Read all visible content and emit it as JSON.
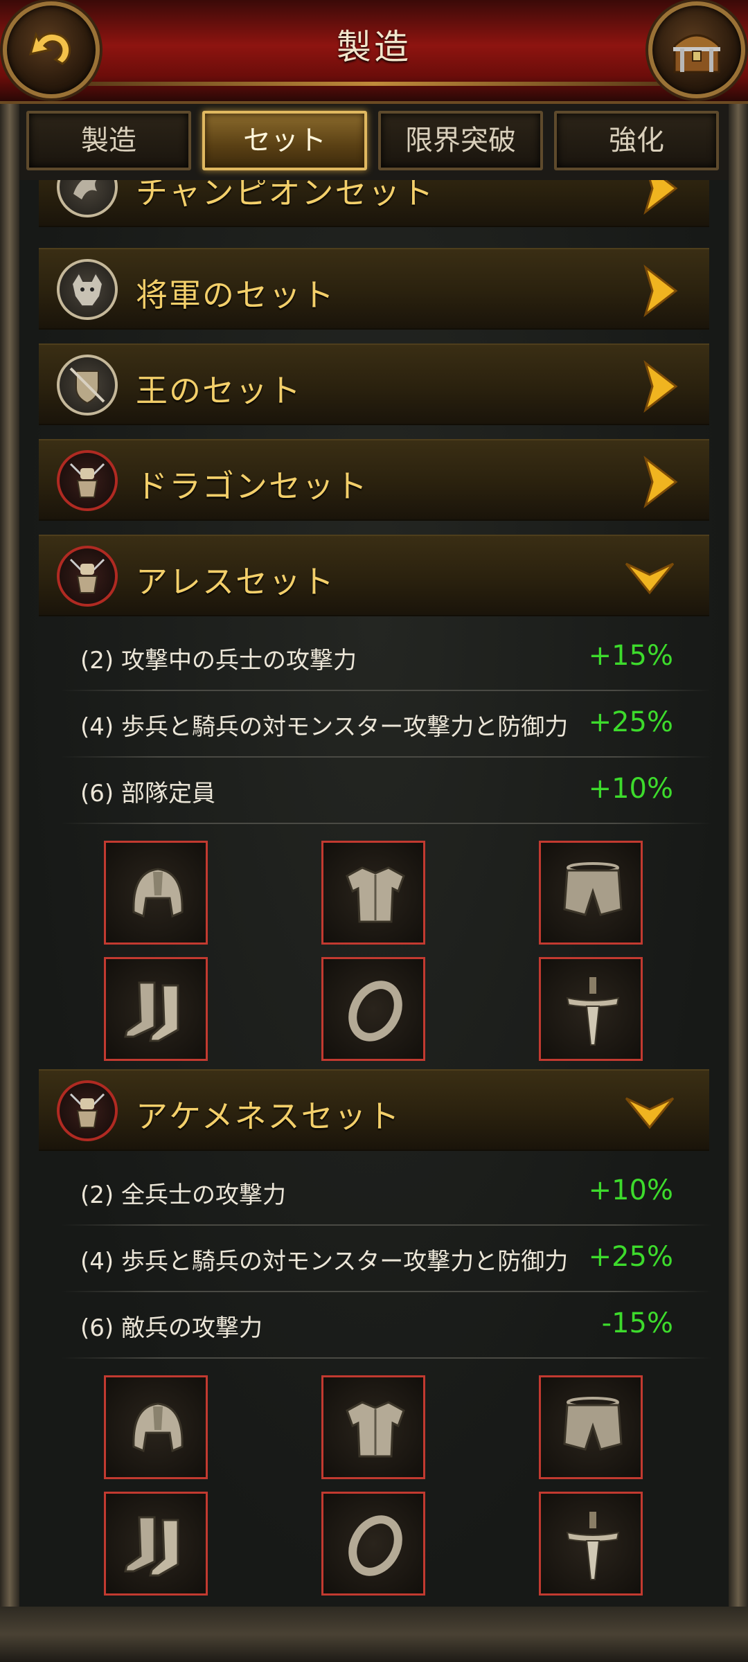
{
  "header": {
    "title": "製造"
  },
  "tabs": [
    {
      "label": "製造",
      "active": false
    },
    {
      "label": "セット",
      "active": true
    },
    {
      "label": "限界突破",
      "active": false
    },
    {
      "label": "強化",
      "active": false
    }
  ],
  "sets": [
    {
      "name": "チャンピオンセット",
      "icon": "dragon-crest-icon",
      "expanded": false
    },
    {
      "name": "将軍のセット",
      "icon": "wolf-head-icon",
      "expanded": false
    },
    {
      "name": "王のセット",
      "icon": "shield-sword-icon",
      "expanded": false
    },
    {
      "name": "ドラゴンセット",
      "icon": "armor-fist-icon",
      "expanded": false
    },
    {
      "name": "アレスセット",
      "icon": "armor-fist-icon",
      "expanded": true,
      "bonuses": [
        {
          "text": "(2) 攻撃中の兵士の攻撃力",
          "value": "+15%"
        },
        {
          "text": "(4) 歩兵と騎兵の対モンスター攻撃力と防御力",
          "value": "+25%"
        },
        {
          "text": "(6) 部隊定員",
          "value": "+10%"
        }
      ],
      "items": [
        "helmet-icon",
        "chest-armor-icon",
        "leg-armor-icon",
        "boots-icon",
        "ring-icon",
        "sword-icon"
      ]
    },
    {
      "name": "アケメネスセット",
      "icon": "armor-fist-icon",
      "expanded": true,
      "bonuses": [
        {
          "text": "(2) 全兵士の攻撃力",
          "value": "+10%"
        },
        {
          "text": "(4) 歩兵と騎兵の対モンスター攻撃力と防御力",
          "value": "+25%"
        },
        {
          "text": "(6) 敵兵の攻撃力",
          "value": "-15%"
        }
      ],
      "items": [
        "helmet-icon",
        "chest-armor-icon",
        "leg-armor-icon",
        "boots-icon",
        "ring-icon",
        "sword-icon"
      ]
    }
  ],
  "colors": {
    "set_name": "#f3cf6a",
    "bonus_value": "#3ddb2c",
    "slot_border": "#c23a30",
    "header": "#8e1410"
  }
}
